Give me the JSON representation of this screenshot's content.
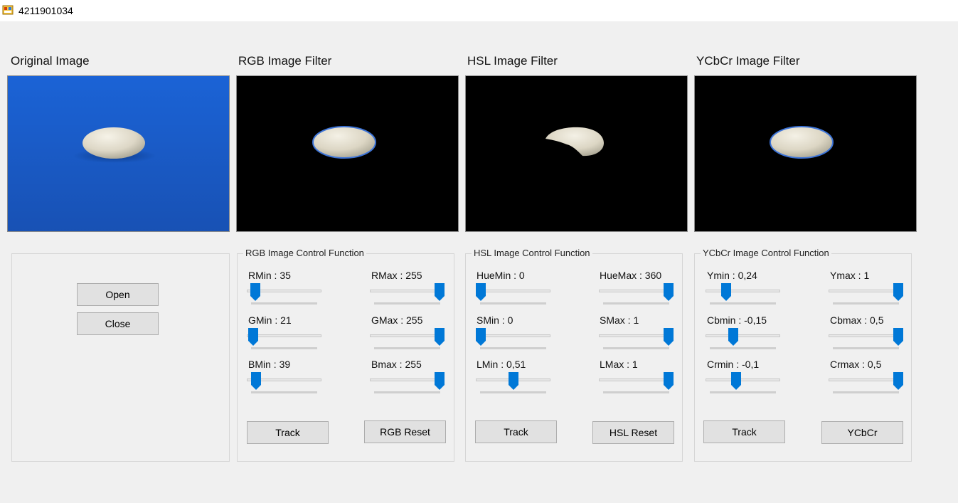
{
  "window": {
    "title": "4211901034"
  },
  "colors": {
    "accent": "#0078d7",
    "bg": "#f0f0f0",
    "blue_bg": "#1d5fc9"
  },
  "sections": {
    "original": {
      "title": "Original Image"
    },
    "rgb": {
      "title": "RGB Image Filter"
    },
    "hsl": {
      "title": "HSL Image Filter"
    },
    "ycbcr": {
      "title": "YCbCr Image Filter"
    }
  },
  "controls": {
    "open_label": "Open",
    "close_label": "Close"
  },
  "rgb_panel": {
    "legend": "RGB Image Control Function",
    "sliders": [
      {
        "label": "RMin : 35",
        "value": 0.06
      },
      {
        "label": "RMax : 255",
        "value": 1.0
      },
      {
        "label": "GMin : 21",
        "value": 0.02
      },
      {
        "label": "GMax : 255",
        "value": 1.0
      },
      {
        "label": "BMin : 39",
        "value": 0.07
      },
      {
        "label": "Bmax : 255",
        "value": 1.0
      }
    ],
    "track_label": "Track",
    "reset_label": "RGB Reset"
  },
  "hsl_panel": {
    "legend": "HSL Image Control Function",
    "sliders": [
      {
        "label": "HueMin : 0",
        "value": 0.0
      },
      {
        "label": "HueMax : 360",
        "value": 1.0
      },
      {
        "label": "SMin : 0",
        "value": 0.0
      },
      {
        "label": "SMax : 1",
        "value": 1.0
      },
      {
        "label": "LMin : 0,51",
        "value": 0.51
      },
      {
        "label": "LMax : 1",
        "value": 1.0
      }
    ],
    "track_label": "Track",
    "reset_label": "HSL Reset"
  },
  "ycbcr_panel": {
    "legend": "YCbCr Image Control Function",
    "sliders": [
      {
        "label": "Ymin : 0,24",
        "value": 0.24
      },
      {
        "label": "Ymax : 1",
        "value": 1.0
      },
      {
        "label": "Cbmin : -0,15",
        "value": 0.35
      },
      {
        "label": "Cbmax : 0,5",
        "value": 1.0
      },
      {
        "label": "Crmin : -0,1",
        "value": 0.4
      },
      {
        "label": "Crmax : 0,5",
        "value": 1.0
      }
    ],
    "track_label": "Track",
    "reset_label": "YCbCr"
  }
}
